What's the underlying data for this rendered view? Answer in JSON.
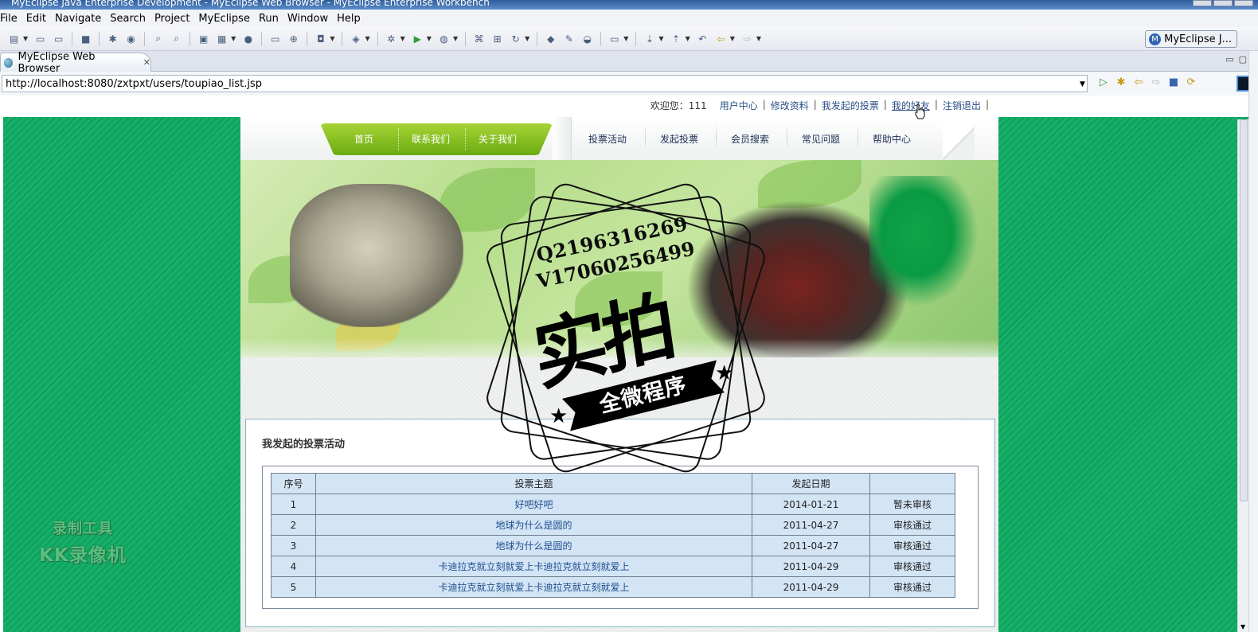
{
  "window": {
    "title": "MyEclipse Java Enterprise Development - MyEclipse Web Browser - MyEclipse Enterprise Workbench"
  },
  "menubar": {
    "items": [
      "File",
      "Edit",
      "Navigate",
      "Search",
      "Project",
      "MyEclipse",
      "Run",
      "Window",
      "Help"
    ]
  },
  "toolbar": {
    "perspective_label": "MyEclipse J..."
  },
  "editor": {
    "tab_label": "MyEclipse Web Browser",
    "tab_close": "✕"
  },
  "browser": {
    "url": "http://localhost:8080/zxtpxt/users/toupiao_list.jsp"
  },
  "site": {
    "welcome": "欢迎您：111",
    "top_links": [
      "用户中心",
      "修改资料",
      "我发起的投票",
      "我的好友",
      "注销退出"
    ],
    "green_nav": [
      "首页",
      "联系我们",
      "关于我们"
    ],
    "main_nav": [
      "投票活动",
      "发起投票",
      "会员搜索",
      "常见问题",
      "帮助中心"
    ],
    "section_title": "我发起的投票活动",
    "table": {
      "headers": [
        "序号",
        "投票主题",
        "发起日期",
        ""
      ],
      "rows": [
        [
          "1",
          "好吧好吧",
          "2014-01-21",
          "暂未审核"
        ],
        [
          "2",
          "地球为什么是圆的",
          "2011-04-27",
          "审核通过"
        ],
        [
          "3",
          "地球为什么是圆的",
          "2011-04-27",
          "审核通过"
        ],
        [
          "4",
          "卡迪拉克就立刻就爱上卡迪拉克就立刻就爱上",
          "2011-04-29",
          "审核通过"
        ],
        [
          "5",
          "卡迪拉克就立刻就爱上卡迪拉克就立刻就爱上",
          "2011-04-29",
          "审核通过"
        ]
      ]
    }
  },
  "overlay": {
    "stamp_line1": "Q2196316269",
    "stamp_line2": "V17060256499",
    "stamp_big": "实拍",
    "stamp_ribbon": "全微程序",
    "watermark_line1": "录制工具",
    "watermark_line2": "KK录像机"
  },
  "colors": {
    "stripe_green": "#17b069",
    "nav_green": "#8cc224",
    "table_bg": "#d3e4f5"
  }
}
